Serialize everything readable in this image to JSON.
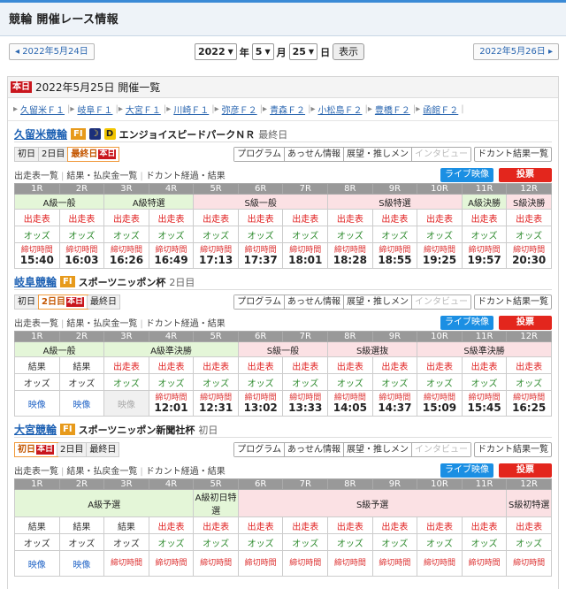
{
  "header": {
    "title": "競輪 開催レース情報"
  },
  "datenav": {
    "prev": "◂ 2022年5月24日",
    "next": "2022年5月26日 ▸",
    "year": "2022",
    "year_unit": "年",
    "month": "5",
    "month_unit": "月",
    "day": "25",
    "day_unit": "日",
    "show_button": "表示"
  },
  "today": {
    "badge": "本日",
    "heading": "2022年5月25日 開催一覧"
  },
  "venue_links": [
    "久留米Ｆ１",
    "岐阜Ｆ１",
    "大宮Ｆ１",
    "川崎Ｆ１",
    "弥彦Ｆ２",
    "青森Ｆ２",
    "小松島Ｆ２",
    "豊橋Ｆ２",
    "函館Ｆ２"
  ],
  "common": {
    "tools1": [
      "プログラム",
      "あっせん情報",
      "展望・推しメン",
      "インタビュー"
    ],
    "tools2": "ドカント結果一覧",
    "links": [
      "出走表一覧",
      "結果・払戻金一覧",
      "ドカント経過・結果"
    ],
    "live": "ライブ映像",
    "vote": "投票",
    "races": [
      "1R",
      "2R",
      "3R",
      "4R",
      "5R",
      "6R",
      "7R",
      "8R",
      "9R",
      "10R",
      "11R",
      "12R"
    ],
    "time_label": "締切時間"
  },
  "venues": [
    {
      "name": "久留米競輪",
      "grade": "FI",
      "night": "☽",
      "dbadge": "D",
      "event": "エンジョイスピードパークＮＲ",
      "day": "最終日",
      "tabs": [
        {
          "label": "初日",
          "cur": false,
          "mini": ""
        },
        {
          "label": "2日目",
          "cur": false,
          "mini": ""
        },
        {
          "label": "最終日",
          "cur": true,
          "mini": "本日"
        }
      ],
      "classes": [
        {
          "label": "A級一般",
          "span": 2,
          "c": "A"
        },
        {
          "label": "A級特選",
          "span": 2,
          "c": "A"
        },
        {
          "label": "S級一般",
          "span": 3,
          "c": "S"
        },
        {
          "label": "S級特選",
          "span": 3,
          "c": "S"
        },
        {
          "label": "A級決勝",
          "span": 1,
          "c": "A"
        },
        {
          "label": "S級決勝",
          "span": 1,
          "c": "S"
        }
      ],
      "row1": [
        "出走表",
        "出走表",
        "出走表",
        "出走表",
        "出走表",
        "出走表",
        "出走表",
        "出走表",
        "出走表",
        "出走表",
        "出走表",
        "出走表"
      ],
      "row2": [
        "オッズ",
        "オッズ",
        "オッズ",
        "オッズ",
        "オッズ",
        "オッズ",
        "オッズ",
        "オッズ",
        "オッズ",
        "オッズ",
        "オッズ",
        "オッズ"
      ],
      "times": [
        "15:40",
        "16:03",
        "16:26",
        "16:49",
        "17:13",
        "17:37",
        "18:01",
        "18:28",
        "18:55",
        "19:25",
        "19:57",
        "20:30"
      ]
    },
    {
      "name": "岐阜競輪",
      "grade": "FI",
      "event": "スポーツニッポン杯",
      "day": "2日目",
      "tabs": [
        {
          "label": "初日",
          "cur": false,
          "mini": ""
        },
        {
          "label": "2日目",
          "cur": true,
          "mini": "本日"
        },
        {
          "label": "最終日",
          "cur": false,
          "mini": ""
        }
      ],
      "classes": [
        {
          "label": "A級一般",
          "span": 2,
          "c": "A"
        },
        {
          "label": "A級準決勝",
          "span": 3,
          "c": "A"
        },
        {
          "label": "S級一般",
          "span": 2,
          "c": "S"
        },
        {
          "label": "S級選抜",
          "span": 2,
          "c": "S"
        },
        {
          "label": "S級準決勝",
          "span": 3,
          "c": "S"
        }
      ],
      "row1": [
        "結果",
        "結果",
        "出走表",
        "出走表",
        "出走表",
        "出走表",
        "出走表",
        "出走表",
        "出走表",
        "出走表",
        "出走表",
        "出走表"
      ],
      "row2": [
        "オッズ",
        "オッズ",
        "オッズ",
        "オッズ",
        "オッズ",
        "オッズ",
        "オッズ",
        "オッズ",
        "オッズ",
        "オッズ",
        "オッズ",
        "オッズ"
      ],
      "video": [
        "映像",
        "映像",
        "映像"
      ],
      "times": [
        "",
        "",
        "",
        "12:01",
        "12:31",
        "13:02",
        "13:33",
        "14:05",
        "14:37",
        "15:09",
        "15:45",
        "16:25"
      ]
    },
    {
      "name": "大宮競輪",
      "grade": "FI",
      "event": "スポーツニッポン新聞社杯",
      "day": "初日",
      "tabs": [
        {
          "label": "初日",
          "cur": true,
          "mini": "本日"
        },
        {
          "label": "2日目",
          "cur": false,
          "mini": ""
        },
        {
          "label": "最終日",
          "cur": false,
          "mini": ""
        }
      ],
      "classes": [
        {
          "label": "A級予選",
          "span": 4,
          "c": "A"
        },
        {
          "label": "A級初日特選",
          "span": 1,
          "c": "A"
        },
        {
          "label": "S級予選",
          "span": 6,
          "c": "S"
        },
        {
          "label": "S級初特選",
          "span": 1,
          "c": "S"
        }
      ],
      "row1": [
        "結果",
        "結果",
        "結果",
        "出走表",
        "出走表",
        "出走表",
        "出走表",
        "出走表",
        "出走表",
        "出走表",
        "出走表",
        "出走表"
      ],
      "row2": [
        "オッズ",
        "オッズ",
        "オッズ",
        "オッズ",
        "オッズ",
        "オッズ",
        "オッズ",
        "オッズ",
        "オッズ",
        "オッズ",
        "オッズ",
        "オッズ"
      ],
      "video": [
        "映像",
        "映像"
      ]
    }
  ]
}
